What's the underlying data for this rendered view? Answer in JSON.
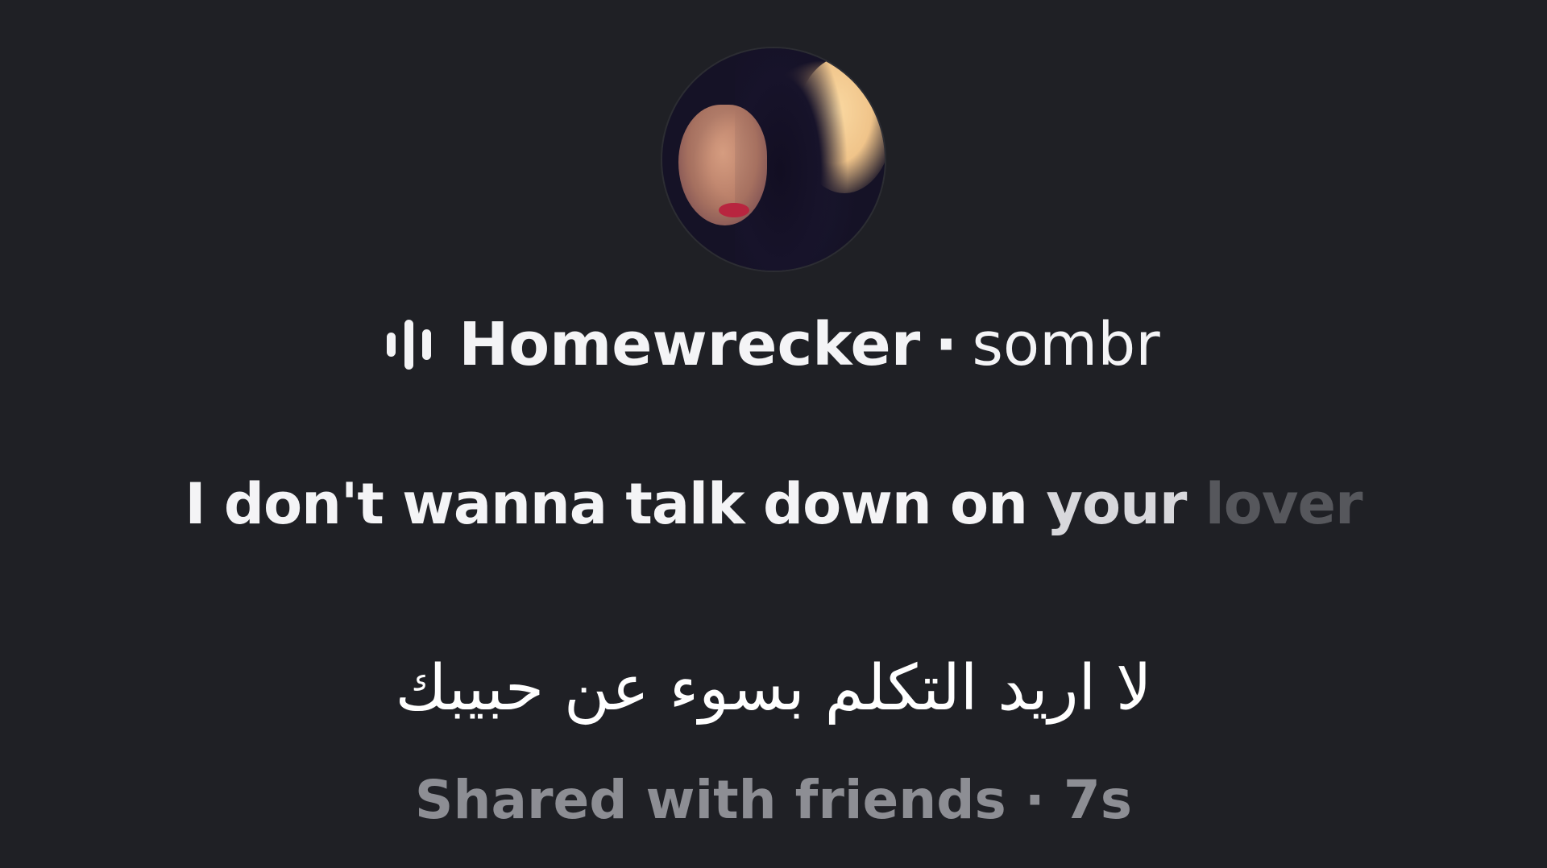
{
  "post": {
    "avatar_icon": "profile-photo",
    "song": {
      "icon": "audio-waveform-icon",
      "title": "Homewrecker",
      "separator": "·",
      "artist": "sombr"
    },
    "lyric": {
      "sung": "I don't wanna talk down on",
      "current": "your",
      "upcoming": "lover"
    },
    "translation": "لا اريد التكلم بسوء عن حبيبك",
    "footer": {
      "audience": "Shared with friends",
      "separator": "·",
      "age": "7s"
    }
  },
  "colors": {
    "background": "#1f2025",
    "text_primary": "#f4f4f6",
    "text_dim": "#56575c",
    "text_secondary": "#8d8e94"
  }
}
